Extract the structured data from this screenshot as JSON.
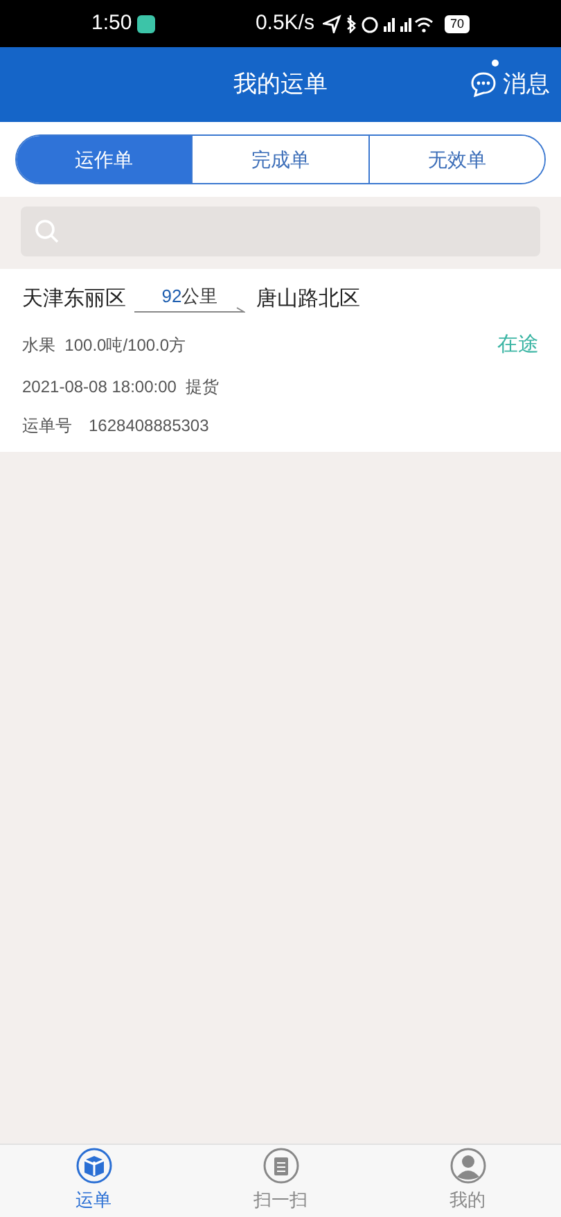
{
  "status_bar": {
    "time": "1:50",
    "speed": "0.5K/s",
    "battery": "70"
  },
  "header": {
    "title": "我的运单",
    "message_button": "消息",
    "has_unread": true
  },
  "tabs": [
    {
      "label": "运作单",
      "selected": true
    },
    {
      "label": "完成单",
      "selected": false
    },
    {
      "label": "无效单",
      "selected": false
    }
  ],
  "orders": [
    {
      "from": "天津东丽区",
      "distance": "92",
      "distance_unit": "公里",
      "to": "唐山路北区",
      "cargo": "水果  100.0吨/100.0方",
      "status": "在途",
      "time": "2021-08-08 18:00:00  提货",
      "number_label": "运单号",
      "number": "1628408885303"
    }
  ],
  "bottom_nav": [
    {
      "label": "运单",
      "kind": "box",
      "selected": true
    },
    {
      "label": "扫一扫",
      "kind": "clipboard",
      "selected": false
    },
    {
      "label": "我的",
      "kind": "person",
      "selected": false
    }
  ]
}
